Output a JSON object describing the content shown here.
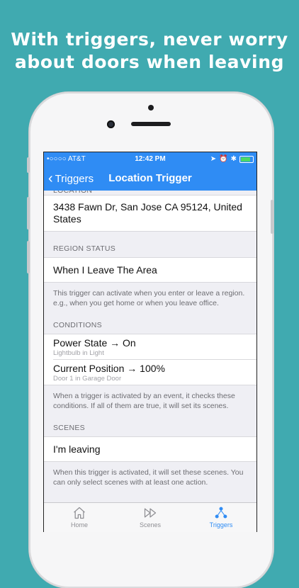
{
  "headline": {
    "line1": "With triggers, never worry",
    "line2": "about doors when leaving"
  },
  "status_bar": {
    "carrier": "•○○○○ AT&T",
    "time": "12:42 PM"
  },
  "nav": {
    "back_label": "Triggers",
    "title": "Location Trigger"
  },
  "location": {
    "section_label": "LOCATION",
    "address": "3438 Fawn Dr, San Jose CA 95124, United States"
  },
  "region_status": {
    "header": "REGION STATUS",
    "value": "When I Leave The Area",
    "note": "This trigger can activate when you enter or leave a region. e.g., when you get home or when you leave office."
  },
  "conditions": {
    "header": "CONDITIONS",
    "items": [
      {
        "title": "Power State → On",
        "subtitle": "Lightbulb in Light"
      },
      {
        "title": "Current Position → 100%",
        "subtitle": "Door 1 in Garage Door"
      }
    ],
    "note": "When a trigger is activated by an event, it checks these conditions. If all of them are true, it will set its scenes."
  },
  "scenes": {
    "header": "SCENES",
    "items": [
      "I'm leaving"
    ],
    "note": "When this trigger is activated, it will set these scenes. You can only select scenes with at least one action."
  },
  "tabs": [
    {
      "label": "Home",
      "icon": "house-icon",
      "active": false
    },
    {
      "label": "Scenes",
      "icon": "play-forward-icon",
      "active": false
    },
    {
      "label": "Triggers",
      "icon": "triggers-icon",
      "active": true
    }
  ],
  "colors": {
    "background": "#40AAB0",
    "accent": "#2F8CF4",
    "group_bg": "#EFEFF4"
  }
}
